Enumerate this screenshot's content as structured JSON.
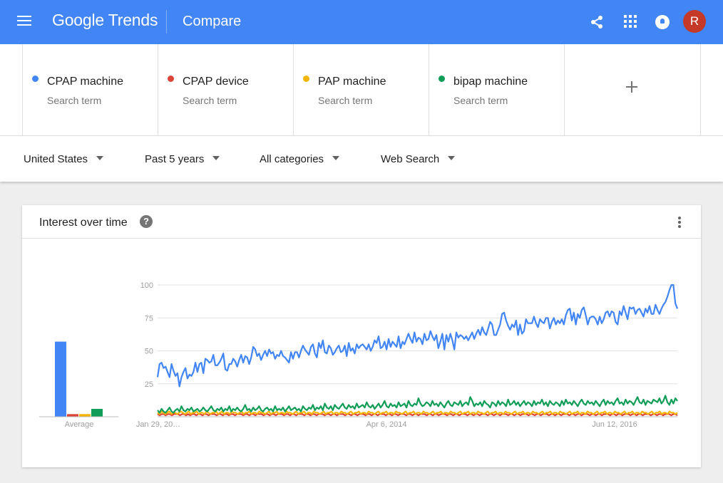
{
  "topbar": {
    "logo": "Google Trends",
    "title": "Compare",
    "avatar_letter": "R",
    "color": "#4285f4"
  },
  "terms": [
    {
      "name": "CPAP machine",
      "sub": "Search term",
      "color": "#4285f4"
    },
    {
      "name": "CPAP device",
      "sub": "Search term",
      "color": "#db4437"
    },
    {
      "name": "PAP machine",
      "sub": "Search term",
      "color": "#f4b400"
    },
    {
      "name": "bipap machine",
      "sub": "Search term",
      "color": "#0f9d58"
    }
  ],
  "filters": {
    "region": "United States",
    "time": "Past 5 years",
    "category": "All categories",
    "search_type": "Web Search"
  },
  "card": {
    "title": "Interest over time",
    "help": "?"
  },
  "chart_data": [
    {
      "type": "bar",
      "categories": [
        "CPAP machine",
        "CPAP device",
        "PAP machine",
        "bipap machine"
      ],
      "values": [
        57,
        2,
        2,
        6
      ],
      "xlabel": "Average",
      "ylim": [
        0,
        100
      ]
    },
    {
      "type": "line",
      "ylim": [
        0,
        100
      ],
      "yticks": [
        "25",
        "50",
        "75",
        "100"
      ],
      "xticks": [
        "Jan 29, 20…",
        "Apr 6, 2014",
        "Jun 12, 2016"
      ],
      "grid": true,
      "series": [
        {
          "name": "CPAP machine",
          "color": "#4285f4",
          "values": [
            30,
            40,
            41,
            37,
            38,
            34,
            30,
            40,
            35,
            31,
            33,
            23,
            30,
            34,
            37,
            29,
            32,
            31,
            34,
            41,
            34,
            40,
            41,
            33,
            44,
            43,
            41,
            42,
            47,
            39,
            39,
            41,
            44,
            48,
            36,
            35,
            40,
            40,
            44,
            42,
            38,
            43,
            47,
            41,
            46,
            45,
            40,
            45,
            53,
            51,
            46,
            48,
            43,
            47,
            50,
            46,
            51,
            48,
            49,
            44,
            47,
            46,
            50,
            46,
            45,
            43,
            41,
            49,
            44,
            49,
            49,
            45,
            50,
            54,
            51,
            49,
            47,
            53,
            55,
            48,
            45,
            56,
            52,
            58,
            49,
            48,
            54,
            52,
            47,
            49,
            52,
            54,
            49,
            50,
            54,
            46,
            56,
            50,
            52,
            48,
            55,
            52,
            54,
            55,
            53,
            51,
            55,
            50,
            53,
            58,
            56,
            61,
            52,
            53,
            57,
            51,
            59,
            53,
            57,
            55,
            53,
            61,
            52,
            57,
            55,
            59,
            63,
            59,
            56,
            64,
            57,
            60,
            59,
            55,
            63,
            58,
            59,
            65,
            61,
            58,
            62,
            52,
            57,
            63,
            51,
            62,
            57,
            63,
            58,
            51,
            64,
            60,
            62,
            61,
            59,
            61,
            58,
            61,
            64,
            59,
            63,
            66,
            62,
            68,
            64,
            62,
            67,
            72,
            70,
            62,
            62,
            66,
            70,
            78,
            79,
            73,
            69,
            66,
            70,
            68,
            73,
            62,
            70,
            63,
            65,
            74,
            71,
            71,
            71,
            76,
            71,
            68,
            74,
            72,
            71,
            75,
            75,
            67,
            72,
            75,
            70,
            73,
            71,
            74,
            70,
            77,
            81,
            82,
            73,
            79,
            70,
            78,
            75,
            81,
            83,
            77,
            70,
            75,
            76,
            76,
            74,
            70,
            76,
            71,
            74,
            79,
            80,
            76,
            80,
            79,
            72,
            70,
            80,
            77,
            84,
            79,
            74,
            83,
            82,
            83,
            78,
            81,
            82,
            79,
            76,
            82,
            79,
            84,
            78,
            78,
            85,
            81,
            78,
            82,
            85,
            87,
            91,
            96,
            100,
            100,
            86,
            82
          ]
        },
        {
          "name": "CPAP device",
          "color": "#db4437",
          "values": [
            2,
            1,
            2,
            2,
            1,
            2,
            2,
            1,
            2,
            2,
            2,
            1,
            2,
            2,
            1,
            2,
            1,
            2,
            2,
            1,
            2,
            2,
            1,
            2,
            2,
            1,
            2,
            2,
            2,
            1,
            2,
            2,
            1,
            2,
            2,
            1,
            2,
            2,
            1,
            2,
            2,
            2,
            1,
            2,
            2,
            1,
            2,
            2,
            1,
            2,
            2,
            2,
            1,
            2,
            2,
            1,
            2,
            2,
            1,
            2,
            2,
            2,
            1,
            2,
            2,
            1,
            2,
            2,
            1,
            2,
            2,
            2,
            1,
            2,
            2,
            1,
            2,
            2,
            1,
            2,
            2,
            2,
            1,
            2,
            2,
            1,
            2,
            2,
            1,
            2,
            2,
            2,
            1,
            2,
            2,
            1,
            2,
            2,
            1,
            2,
            2,
            2,
            1,
            2,
            2,
            1,
            2,
            2,
            1,
            2,
            2,
            2,
            1,
            2,
            2,
            1,
            2,
            2,
            1,
            2,
            2,
            2,
            1,
            2,
            2,
            1,
            2,
            2,
            1,
            2,
            2,
            2,
            1,
            2,
            2,
            1,
            2,
            2,
            1,
            2,
            2,
            2,
            1,
            2,
            2,
            1,
            2,
            2,
            1,
            2,
            2,
            2,
            1,
            2,
            2,
            1,
            2,
            2,
            1,
            2,
            2,
            2,
            1,
            2,
            2,
            1,
            2,
            2,
            1,
            2,
            2,
            2,
            1,
            2,
            2,
            1,
            2,
            2,
            1,
            2,
            2,
            2,
            1,
            2,
            2,
            1,
            2,
            2,
            1,
            2,
            2,
            2,
            1,
            2,
            2,
            1,
            2,
            2,
            1,
            2,
            2,
            2,
            1,
            2,
            2,
            1,
            2,
            2,
            1,
            2,
            2,
            2,
            1,
            2,
            2,
            1,
            2,
            2,
            1,
            2,
            2,
            2,
            1,
            2,
            2,
            1,
            2,
            2,
            1,
            2,
            2,
            2,
            1,
            2,
            2,
            1,
            2,
            2,
            1,
            2,
            2,
            2,
            1,
            2,
            2,
            1,
            2,
            2,
            1,
            2,
            2,
            2,
            1,
            2,
            2,
            1
          ]
        },
        {
          "name": "PAP machine",
          "color": "#f4b400",
          "values": [
            3,
            2,
            4,
            3,
            2,
            3,
            4,
            2,
            3,
            3,
            2,
            3,
            4,
            3,
            2,
            3,
            4,
            2,
            3,
            3,
            4,
            2,
            3,
            3,
            2,
            4,
            3,
            2,
            3,
            3,
            4,
            2,
            3,
            4,
            2,
            3,
            3,
            2,
            4,
            3,
            3,
            2,
            3,
            4,
            2,
            3,
            3,
            4,
            2,
            3,
            3,
            2,
            4,
            3,
            3,
            2,
            3,
            4,
            2,
            3,
            3,
            4,
            2,
            3,
            3,
            2,
            4,
            3,
            3,
            2,
            3,
            4,
            2,
            3,
            3,
            4,
            2,
            3,
            3,
            2,
            4,
            3,
            3,
            2,
            3,
            4,
            2,
            3,
            3,
            4,
            2,
            3,
            3,
            2,
            4,
            3,
            3,
            2,
            3,
            4,
            2,
            3,
            3,
            4,
            2,
            3,
            3,
            2,
            4,
            3,
            3,
            2,
            3,
            4,
            2,
            3,
            3,
            4,
            2,
            3,
            3,
            2,
            4,
            3,
            3,
            2,
            3,
            4,
            2,
            3,
            3,
            4,
            2,
            3,
            3,
            2,
            4,
            3,
            3,
            2,
            3,
            4,
            2,
            3,
            3,
            4,
            2,
            3,
            3,
            2,
            4,
            3,
            3,
            2,
            3,
            4,
            2,
            3,
            3,
            4,
            2,
            3,
            3,
            2,
            4,
            3,
            3,
            2,
            3,
            4,
            2,
            3,
            3,
            4,
            2,
            3,
            3,
            2,
            4,
            3,
            3,
            2,
            3,
            4,
            2,
            3,
            3,
            4,
            2,
            3,
            3,
            2,
            4,
            3,
            3,
            2,
            3,
            4,
            2,
            3,
            3,
            4,
            2,
            3,
            3,
            2,
            4,
            3,
            3,
            2,
            3,
            4,
            2,
            3,
            3,
            4,
            2,
            3,
            3,
            2,
            4,
            3,
            3,
            2,
            3,
            4,
            2,
            3,
            3,
            4,
            2,
            3,
            3,
            2,
            4,
            3,
            3,
            2,
            3,
            4,
            2,
            3,
            3,
            4,
            2,
            3,
            3,
            2,
            4,
            3,
            3,
            2,
            3,
            4,
            2,
            3,
            3,
            4,
            2,
            3,
            3,
            2,
            4,
            3,
            3,
            2,
            3
          ]
        },
        {
          "name": "bipap machine",
          "color": "#0f9d58",
          "values": [
            5,
            3,
            6,
            4,
            3,
            5,
            7,
            4,
            3,
            5,
            6,
            4,
            8,
            5,
            4,
            6,
            5,
            7,
            4,
            5,
            6,
            4,
            5,
            7,
            5,
            4,
            6,
            8,
            5,
            4,
            6,
            5,
            7,
            4,
            6,
            5,
            8,
            4,
            6,
            5,
            7,
            5,
            4,
            6,
            9,
            5,
            6,
            4,
            7,
            5,
            6,
            8,
            5,
            4,
            6,
            7,
            5,
            6,
            4,
            8,
            5,
            6,
            5,
            7,
            4,
            6,
            8,
            5,
            6,
            7,
            5,
            6,
            4,
            8,
            6,
            5,
            7,
            6,
            9,
            5,
            7,
            6,
            8,
            5,
            10,
            7,
            6,
            8,
            5,
            9,
            7,
            6,
            8,
            10,
            7,
            6,
            9,
            7,
            8,
            6,
            10,
            7,
            8,
            9,
            7,
            11,
            8,
            7,
            9,
            6,
            8,
            10,
            7,
            9,
            12,
            8,
            7,
            10,
            8,
            9,
            7,
            11,
            8,
            9,
            10,
            7,
            12,
            9,
            8,
            10,
            9,
            14,
            10,
            8,
            9,
            11,
            10,
            8,
            12,
            9,
            10,
            8,
            11,
            9,
            7,
            10,
            12,
            9,
            8,
            11,
            10,
            9,
            12,
            8,
            10,
            11,
            9,
            15,
            12,
            8,
            10,
            9,
            11,
            8,
            12,
            10,
            9,
            7,
            11,
            10,
            8,
            12,
            9,
            11,
            10,
            8,
            13,
            9,
            10,
            12,
            9,
            11,
            8,
            10,
            12,
            9,
            11,
            10,
            8,
            12,
            9,
            11,
            10,
            13,
            9,
            11,
            8,
            12,
            10,
            9,
            11,
            10,
            8,
            12,
            9,
            13,
            10,
            11,
            9,
            12,
            10,
            8,
            11,
            13,
            10,
            9,
            12,
            10,
            11,
            9,
            12,
            10,
            8,
            11,
            13,
            9,
            12,
            10,
            11,
            9,
            12,
            14,
            10,
            11,
            9,
            13,
            10,
            12,
            11,
            9,
            12,
            15,
            11,
            10,
            13,
            9,
            12,
            11,
            10,
            13,
            12,
            11,
            14,
            10,
            12,
            16,
            11,
            9,
            13,
            10,
            14,
            12
          ]
        }
      ]
    }
  ]
}
